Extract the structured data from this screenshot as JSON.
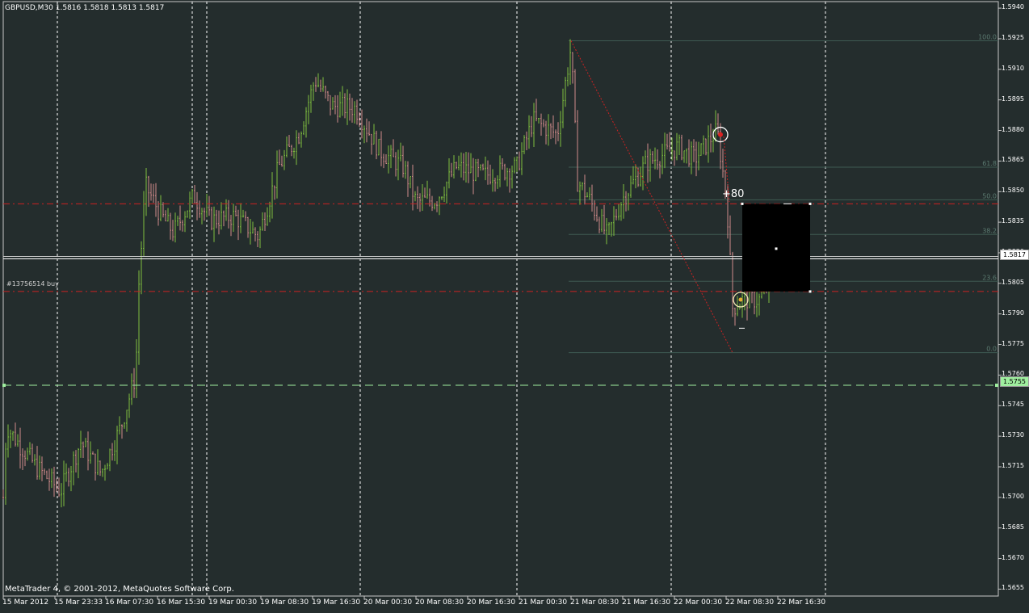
{
  "header": {
    "symbol": "GBPUSD,M30",
    "ohlc": "1.5816 1.5818 1.5813 1.5817"
  },
  "footer": {
    "copyright": "MetaTrader 4, © 2001-2012, MetaQuotes Software Corp."
  },
  "order": {
    "label": "#13756514 buy"
  },
  "annotation": {
    "profit_text": "+80"
  },
  "current_price": {
    "value": "1.5817",
    "color": "#ffffff"
  },
  "stop_level": {
    "value": "1.5755",
    "color": "#9fef9f"
  },
  "price_axis": {
    "labels": [
      "1.5940",
      "1.5925",
      "1.5910",
      "1.5895",
      "1.5880",
      "1.5865",
      "1.5850",
      "1.5835",
      "1.5820",
      "1.5805",
      "1.5790",
      "1.5775",
      "1.5760",
      "1.5745",
      "1.5730",
      "1.5715",
      "1.5700",
      "1.5685",
      "1.5670",
      "1.5655"
    ]
  },
  "time_axis": {
    "labels": [
      "15 Mar 2012",
      "15 Mar 23:33",
      "16 Mar 07:30",
      "16 Mar 15:30",
      "19 Mar 00:30",
      "19 Mar 08:30",
      "19 Mar 16:30",
      "20 Mar 00:30",
      "20 Mar 08:30",
      "20 Mar 16:30",
      "21 Mar 00:30",
      "21 Mar 08:30",
      "21 Mar 16:30",
      "22 Mar 00:30",
      "22 Mar 08:30",
      "22 Mar 16:30"
    ]
  },
  "fibonacci": {
    "levels": [
      {
        "label": "100.0",
        "price": 1.5924
      },
      {
        "label": "61.8",
        "price": 1.5862
      },
      {
        "label": "50.0",
        "price": 1.5846
      },
      {
        "label": "38.2",
        "price": 1.5829
      },
      {
        "label": "23.6",
        "price": 1.5806
      },
      {
        "label": "0.0",
        "price": 1.5771
      }
    ]
  },
  "chart_data": {
    "type": "candlestick",
    "symbol": "GBPUSD",
    "timeframe": "M30",
    "ylim": [
      1.5652,
      1.5944
    ],
    "horizontal_lines": [
      {
        "price": 1.5844,
        "style": "dash-dot",
        "color": "#cc2222"
      },
      {
        "price": 1.5801,
        "style": "dash-dot",
        "color": "#cc2222"
      },
      {
        "price": 1.5817,
        "style": "solid",
        "color": "#ffffff"
      },
      {
        "price": 1.5755,
        "style": "dashed",
        "color": "#9fef9f"
      }
    ],
    "anchors": [
      {
        "x": 0,
        "price": 1.5665
      },
      {
        "x": 8,
        "price": 1.5735
      },
      {
        "x": 22,
        "price": 1.5727
      },
      {
        "x": 45,
        "price": 1.5715
      },
      {
        "x": 75,
        "price": 1.5703
      },
      {
        "x": 100,
        "price": 1.5727
      },
      {
        "x": 125,
        "price": 1.5712
      },
      {
        "x": 150,
        "price": 1.5735
      },
      {
        "x": 168,
        "price": 1.576
      },
      {
        "x": 172,
        "price": 1.5805
      },
      {
        "x": 180,
        "price": 1.5853
      },
      {
        "x": 200,
        "price": 1.5838
      },
      {
        "x": 215,
        "price": 1.583
      },
      {
        "x": 240,
        "price": 1.5848
      },
      {
        "x": 260,
        "price": 1.5836
      },
      {
        "x": 290,
        "price": 1.5838
      },
      {
        "x": 320,
        "price": 1.5828
      },
      {
        "x": 345,
        "price": 1.5862
      },
      {
        "x": 370,
        "price": 1.5878
      },
      {
        "x": 390,
        "price": 1.5905
      },
      {
        "x": 410,
        "price": 1.5892
      },
      {
        "x": 440,
        "price": 1.5891
      },
      {
        "x": 470,
        "price": 1.587
      },
      {
        "x": 500,
        "price": 1.5862
      },
      {
        "x": 515,
        "price": 1.5845
      },
      {
        "x": 540,
        "price": 1.5846
      },
      {
        "x": 565,
        "price": 1.5862
      },
      {
        "x": 600,
        "price": 1.5858
      },
      {
        "x": 640,
        "price": 1.5862
      },
      {
        "x": 660,
        "price": 1.5885
      },
      {
        "x": 690,
        "price": 1.5878
      },
      {
        "x": 707,
        "price": 1.5921
      },
      {
        "x": 715,
        "price": 1.5855
      },
      {
        "x": 730,
        "price": 1.5846
      },
      {
        "x": 752,
        "price": 1.5828
      },
      {
        "x": 770,
        "price": 1.5846
      },
      {
        "x": 800,
        "price": 1.5864
      },
      {
        "x": 840,
        "price": 1.5872
      },
      {
        "x": 860,
        "price": 1.5866
      },
      {
        "x": 888,
        "price": 1.588
      },
      {
        "x": 900,
        "price": 1.5845
      },
      {
        "x": 907,
        "price": 1.5793
      },
      {
        "x": 920,
        "price": 1.5797
      },
      {
        "x": 940,
        "price": 1.5797
      },
      {
        "x": 962,
        "price": 1.5812
      },
      {
        "x": 985,
        "price": 1.5816
      }
    ]
  }
}
